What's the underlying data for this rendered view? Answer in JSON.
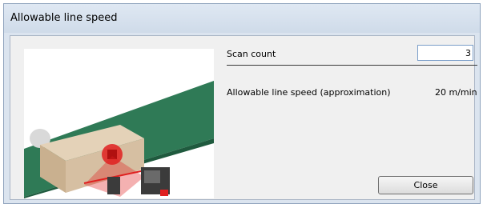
{
  "window": {
    "title": "Allowable line speed"
  },
  "scan_count": {
    "label": "Scan count",
    "value": "3"
  },
  "line_speed": {
    "label": "Allowable line speed (approximation)",
    "value": "20 m/min"
  },
  "buttons": {
    "close_label": "Close"
  },
  "colors": {
    "belt": "#2f7a56",
    "box": "#d6bfa2",
    "laser": "#e02020",
    "scanner_body": "#3b3b3b"
  },
  "illustration": {
    "icons": [
      "conveyor-belt-illustration",
      "cardboard-box-icon",
      "barcode-scanner-icon",
      "photoelectric-sensor-icon",
      "laser-beam"
    ]
  }
}
